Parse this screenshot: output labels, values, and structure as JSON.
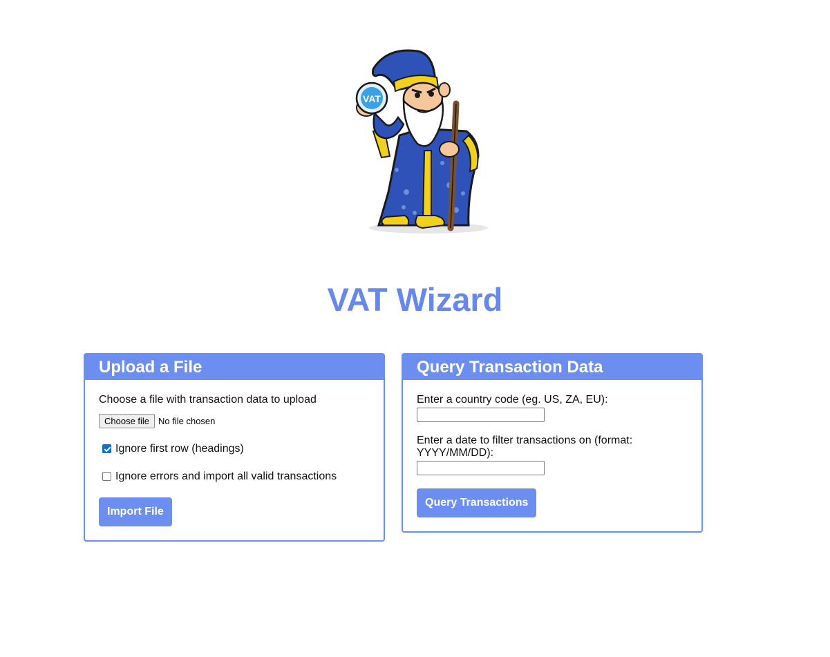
{
  "header": {
    "logo_icon": "vat-wizard-logo-icon",
    "title": "VAT Wizard"
  },
  "upload": {
    "title": "Upload a File",
    "prompt": "Choose a file with transaction data to upload",
    "file_button_label": "Choose file",
    "file_status": "No file chosen",
    "ignore_first_row_label": "Ignore first row (headings)",
    "ignore_first_row_checked": true,
    "ignore_errors_label": "Ignore errors and import all valid transactions",
    "ignore_errors_checked": false,
    "import_button_label": "Import File"
  },
  "query": {
    "title": "Query Transaction Data",
    "country_label": "Enter a country code (eg. US, ZA, EU):",
    "country_value": "",
    "date_label_line1": "Enter a date to filter transactions on (format:",
    "date_label_line2": "YYYY/MM/DD):",
    "date_value": "",
    "query_button_label": "Query Transactions"
  },
  "colors": {
    "accent": "#6b8ef0",
    "title": "#6688ee",
    "checkbox_checked": "#0b6ed9"
  }
}
